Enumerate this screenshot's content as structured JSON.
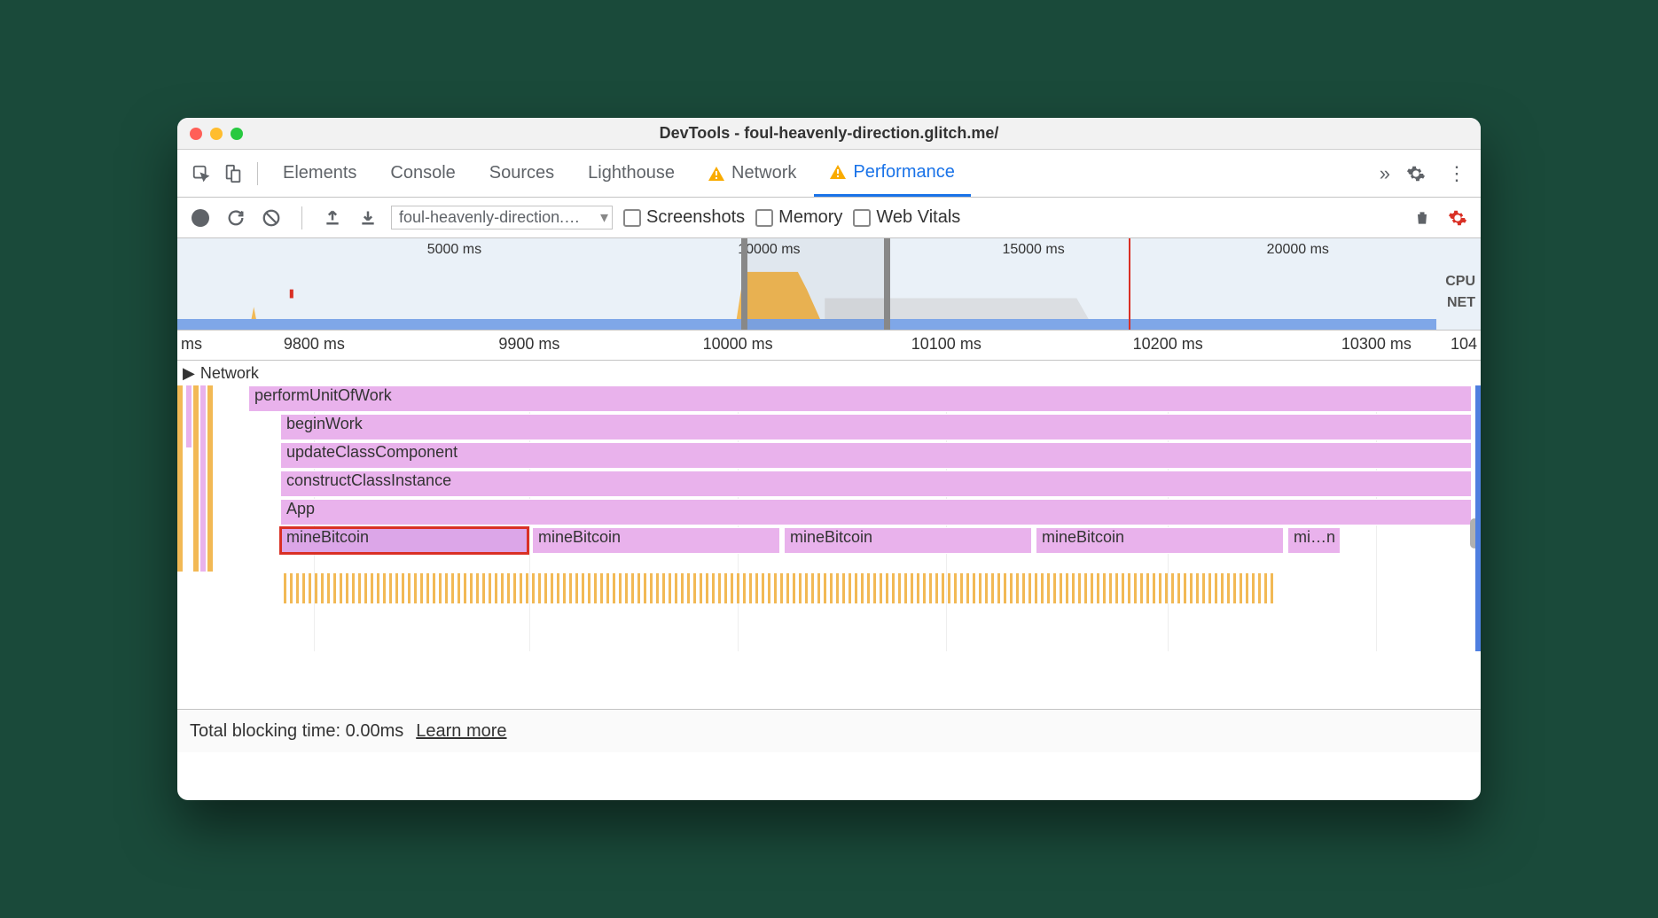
{
  "window": {
    "title": "DevTools - foul-heavenly-direction.glitch.me/"
  },
  "tabs": {
    "elements": "Elements",
    "console": "Console",
    "sources": "Sources",
    "lighthouse": "Lighthouse",
    "network": "Network",
    "performance": "Performance"
  },
  "toolbar": {
    "recording_label": "foul-heavenly-direction.…",
    "screenshots": "Screenshots",
    "memory": "Memory",
    "webvitals": "Web Vitals"
  },
  "overview": {
    "ticks": [
      "5000 ms",
      "10000 ms",
      "15000 ms",
      "20000 ms"
    ],
    "lanes": {
      "cpu": "CPU",
      "net": "NET"
    }
  },
  "ruler": {
    "first": "ms",
    "ticks": [
      "9800 ms",
      "9900 ms",
      "10000 ms",
      "10100 ms",
      "10200 ms",
      "10300 ms"
    ],
    "last": "104"
  },
  "tracks": {
    "network": "Network"
  },
  "flame": {
    "bars": {
      "performUnitOfWork": "performUnitOfWork",
      "beginWork": "beginWork",
      "updateClassComponent": "updateClassComponent",
      "constructClassInstance": "constructClassInstance",
      "app": "App",
      "mineBitcoin": "mineBitcoin",
      "mineLast": "mi…n"
    }
  },
  "footer": {
    "tbt_label": "Total blocking time: ",
    "tbt_value": "0.00ms",
    "learn_more": "Learn more"
  }
}
